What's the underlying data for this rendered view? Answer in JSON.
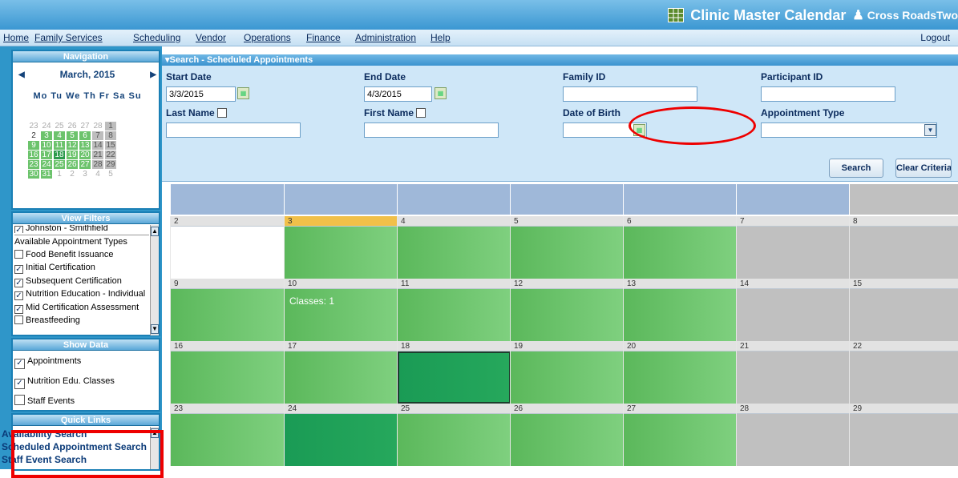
{
  "app_title": "Clinic Master Calendar",
  "user": "Cross RoadsTwo",
  "menu": [
    "Home",
    "Family Services",
    "Scheduling",
    "Vendor",
    "Operations",
    "Finance",
    "Administration",
    "Help"
  ],
  "logout": "Logout",
  "navigation": {
    "title": "Navigation",
    "month": "March, 2015",
    "dow": "Mo Tu We Th Fr Sa Su",
    "days": [
      {
        "d": "23",
        "t": "o"
      },
      {
        "d": "24",
        "t": "o"
      },
      {
        "d": "25",
        "t": "o"
      },
      {
        "d": "26",
        "t": "o"
      },
      {
        "d": "27",
        "t": "o"
      },
      {
        "d": "28",
        "t": "o"
      },
      {
        "d": "1",
        "t": "w"
      },
      {
        "d": "2",
        "t": "n"
      },
      {
        "d": "3",
        "t": "g"
      },
      {
        "d": "4",
        "t": "g"
      },
      {
        "d": "5",
        "t": "g"
      },
      {
        "d": "6",
        "t": "g"
      },
      {
        "d": "7",
        "t": "w"
      },
      {
        "d": "8",
        "t": "w"
      },
      {
        "d": "9",
        "t": "g"
      },
      {
        "d": "10",
        "t": "g"
      },
      {
        "d": "11",
        "t": "g"
      },
      {
        "d": "12",
        "t": "g"
      },
      {
        "d": "13",
        "t": "g"
      },
      {
        "d": "14",
        "t": "w"
      },
      {
        "d": "15",
        "t": "w"
      },
      {
        "d": "16",
        "t": "g"
      },
      {
        "d": "17",
        "t": "g"
      },
      {
        "d": "18",
        "t": "d"
      },
      {
        "d": "19",
        "t": "g"
      },
      {
        "d": "20",
        "t": "g"
      },
      {
        "d": "21",
        "t": "w"
      },
      {
        "d": "22",
        "t": "w"
      },
      {
        "d": "23",
        "t": "g"
      },
      {
        "d": "24",
        "t": "g"
      },
      {
        "d": "25",
        "t": "g"
      },
      {
        "d": "26",
        "t": "g"
      },
      {
        "d": "27",
        "t": "g"
      },
      {
        "d": "28",
        "t": "w"
      },
      {
        "d": "29",
        "t": "w"
      },
      {
        "d": "30",
        "t": "g"
      },
      {
        "d": "31",
        "t": "g"
      },
      {
        "d": "1",
        "t": "o"
      },
      {
        "d": "2",
        "t": "o"
      },
      {
        "d": "3",
        "t": "o"
      },
      {
        "d": "4",
        "t": "o"
      },
      {
        "d": "5",
        "t": "o"
      }
    ]
  },
  "view_filters": {
    "title": "View Filters",
    "top_item": "Johnston - Smithfield",
    "section_label": "Available Appointment Types",
    "items": [
      {
        "label": "Food Benefit Issuance",
        "checked": false
      },
      {
        "label": "Initial Certification",
        "checked": true
      },
      {
        "label": "Subsequent Certification",
        "checked": true
      },
      {
        "label": "Nutrition Education - Individual",
        "checked": true
      },
      {
        "label": "Mid Certification Assessment",
        "checked": true
      },
      {
        "label": "Breastfeeding",
        "checked": false
      }
    ]
  },
  "show_data": {
    "title": "Show Data",
    "items": [
      {
        "label": "Appointments",
        "checked": true
      },
      {
        "label": "Nutrition Edu. Classes",
        "checked": true
      },
      {
        "label": "Staff Events",
        "checked": false
      }
    ]
  },
  "quick_links": {
    "title": "Quick Links",
    "items": [
      "Availability Search",
      "Scheduled Appointment Search",
      "Staff Event Search"
    ]
  },
  "search": {
    "title": "▾Search - Scheduled Appointments",
    "start_date_label": "Start Date",
    "start_date": "3/3/2015",
    "end_date_label": "End Date",
    "end_date": "4/3/2015",
    "family_id_label": "Family ID",
    "participant_id_label": "Participant ID",
    "last_name_label": "Last Name",
    "first_name_label": "First Name",
    "dob_label": "Date of Birth",
    "appt_type_label": "Appointment Type",
    "search_button": "Search",
    "clear_button": "Clear Criteria"
  },
  "calendar": {
    "weeks": [
      [
        {
          "n": "2",
          "s": "wh"
        },
        {
          "n": "3",
          "s": "g1",
          "today": true
        },
        {
          "n": "4",
          "s": "g1"
        },
        {
          "n": "5",
          "s": "g1"
        },
        {
          "n": "6",
          "s": "g1"
        },
        {
          "n": "7",
          "s": "gw"
        },
        {
          "n": "8",
          "s": "gw"
        }
      ],
      [
        {
          "n": "9",
          "s": "g1"
        },
        {
          "n": "10",
          "s": "g1",
          "note": "Classes: 1"
        },
        {
          "n": "11",
          "s": "g1"
        },
        {
          "n": "12",
          "s": "g1"
        },
        {
          "n": "13",
          "s": "g1"
        },
        {
          "n": "14",
          "s": "gw"
        },
        {
          "n": "15",
          "s": "gw"
        }
      ],
      [
        {
          "n": "16",
          "s": "g1"
        },
        {
          "n": "17",
          "s": "g1"
        },
        {
          "n": "18",
          "s": "g2",
          "sel": true
        },
        {
          "n": "19",
          "s": "g1"
        },
        {
          "n": "20",
          "s": "g1"
        },
        {
          "n": "21",
          "s": "gw"
        },
        {
          "n": "22",
          "s": "gw"
        }
      ],
      [
        {
          "n": "23",
          "s": "g1"
        },
        {
          "n": "24",
          "s": "g2"
        },
        {
          "n": "25",
          "s": "g1"
        },
        {
          "n": "26",
          "s": "g1"
        },
        {
          "n": "27",
          "s": "g1"
        },
        {
          "n": "28",
          "s": "gw"
        },
        {
          "n": "29",
          "s": "gw"
        }
      ]
    ]
  }
}
